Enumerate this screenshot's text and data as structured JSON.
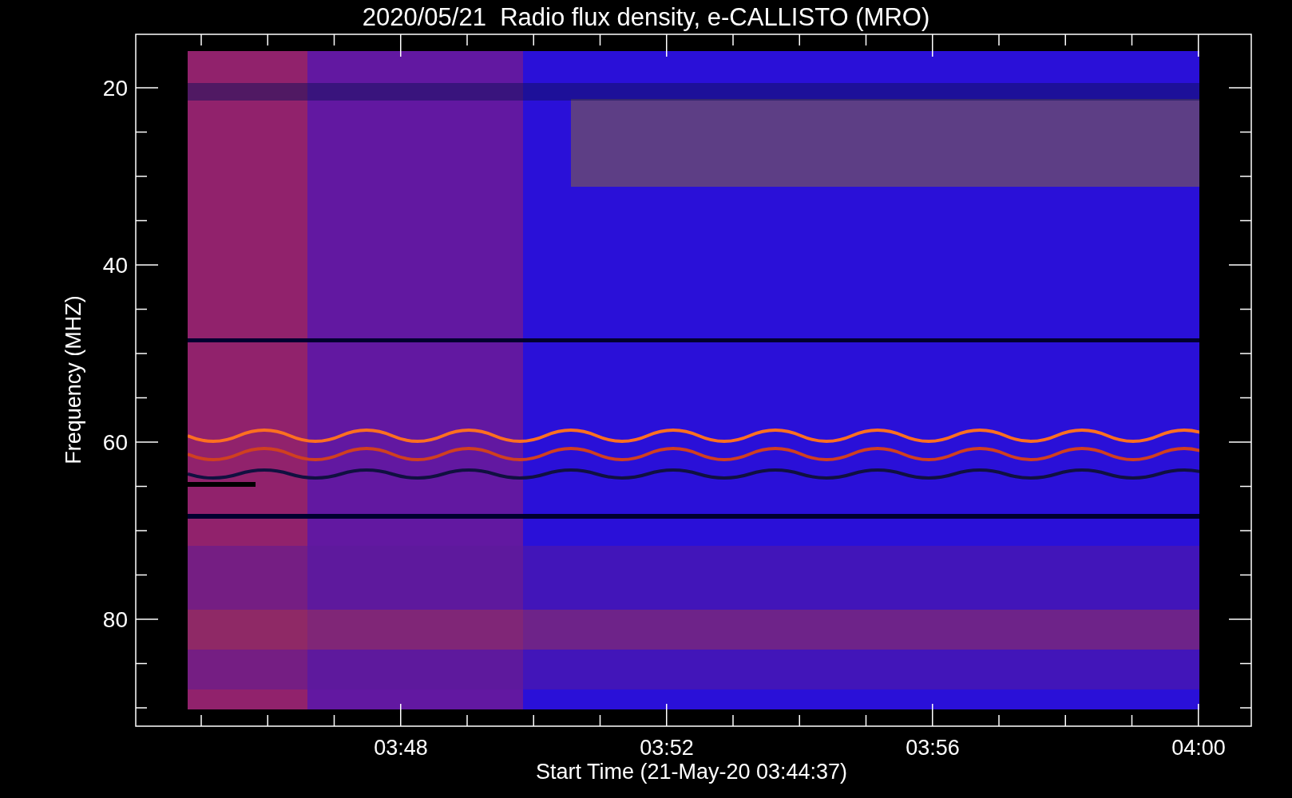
{
  "title": "2020/05/21  Radio flux density, e-CALLISTO (MRO)",
  "y_axis": {
    "label": "Frequency (MHZ)",
    "ticks": [
      "20",
      "40",
      "60",
      "80"
    ]
  },
  "x_axis": {
    "label": "Start Time (21-May-20 03:44:37)",
    "ticks": [
      "03:48",
      "03:52",
      "03:56",
      "04:00"
    ]
  }
}
